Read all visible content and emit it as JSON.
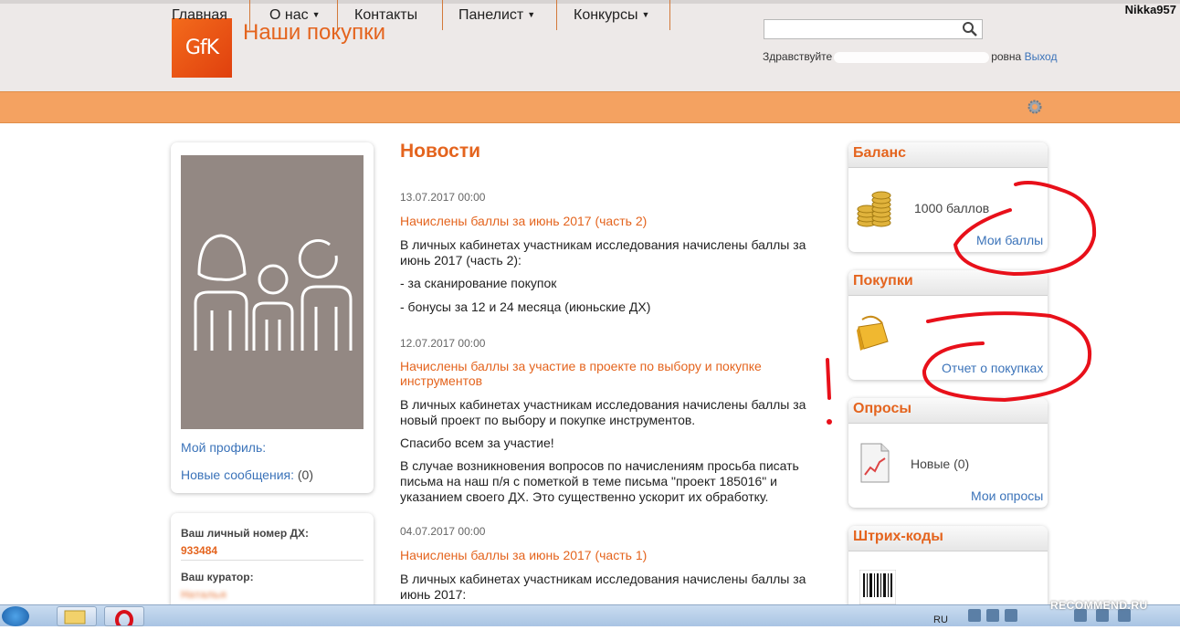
{
  "header": {
    "logo_text": "GfK",
    "site_title": "Наши покупки",
    "search_placeholder": "",
    "greeting_prefix": "Здравствуйте",
    "greeting_suffix": "ровна",
    "logout_label": "Выход",
    "username_badge": "Nikka957"
  },
  "nav": {
    "items": [
      {
        "label": "Главная",
        "has_dropdown": false
      },
      {
        "label": "О нас",
        "has_dropdown": true
      },
      {
        "label": "Контакты",
        "has_dropdown": false
      },
      {
        "label": "Панелист",
        "has_dropdown": true
      },
      {
        "label": "Конкурсы",
        "has_dropdown": true
      }
    ],
    "caret": "▼"
  },
  "sidebar": {
    "my_profile": "Мой профиль:",
    "new_messages": "Новые сообщения:",
    "new_messages_count": "(0)",
    "dx_number_label": "Ваш личный номер ДХ:",
    "dx_number_value": "933484",
    "curator_label": "Ваш куратор:",
    "curator_name_visible": "Наталья"
  },
  "news": {
    "title": "Новости",
    "items": [
      {
        "date": "13.07.2017 00:00",
        "headline": "Начислены баллы за июнь 2017 (часть 2)",
        "paragraphs": [
          "В личных кабинетах участникам исследования начислены баллы за июнь 2017 (часть 2):",
          "- за сканирование покупок",
          "- бонусы за 12 и 24 месяца (июньские ДХ)"
        ]
      },
      {
        "date": "12.07.2017 00:00",
        "headline": "Начислены баллы за участие в проекте по выбору и покупке инструментов",
        "paragraphs": [
          "В личных кабинетах участникам исследования начислены баллы за новый проект по выбору и покупке инструментов.",
          "Спасибо всем за участие!",
          "В случае возникновения вопросов по начислениям просьба писать письма на наш п/я с пометкой в теме письма \"проект 185016\" и указанием своего ДХ. Это существенно ускорит их обработку."
        ]
      },
      {
        "date": "04.07.2017 00:00",
        "headline": "Начислены баллы за июнь 2017 (часть 1)",
        "paragraphs": [
          "В личных кабинетах участникам исследования начислены баллы за июнь 2017:"
        ]
      }
    ]
  },
  "widgets": {
    "balance": {
      "title": "Баланс",
      "amount": "1000 баллов",
      "link": "Мои баллы"
    },
    "purchases": {
      "title": "Покупки",
      "link": "Отчет о покупках"
    },
    "surveys": {
      "title": "Опросы",
      "status": "Новые (0)",
      "link": "Мои опросы"
    },
    "barcodes": {
      "title": "Штрих-коды"
    }
  },
  "annotation": {
    "mark": "!",
    "color": "#e8101a"
  },
  "taskbar": {
    "language": "RU",
    "watermark": "RECOMMEND.RU"
  },
  "colors": {
    "accent": "#e4641e",
    "nav": "#f4a261",
    "link": "#3b73b9",
    "header_bg": "#ede9e8"
  }
}
